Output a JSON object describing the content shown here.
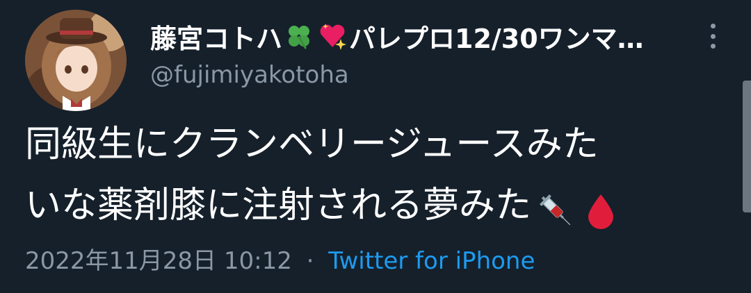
{
  "author": {
    "display_name": "藤宮コトハ",
    "name_suffix": "パレプロ12/30ワンマ…",
    "name_emojis": [
      "four-leaf-clover-icon",
      "sparkling-heart-icon"
    ],
    "handle": "@fujimiyakotoha"
  },
  "tweet": {
    "line1": "同級生にクランベリージュースみた",
    "line2": "いな薬剤膝に注射される夢みた",
    "trailing_emojis": [
      "syringe-icon",
      "drop-of-blood-icon"
    ]
  },
  "meta": {
    "timestamp": "2022年11月28日 10:12",
    "separator": "·",
    "source": "Twitter for iPhone"
  },
  "colors": {
    "background": "#15202b",
    "primary_text": "#ffffff",
    "secondary_text": "#8b98a5",
    "link": "#1d9bf0"
  }
}
